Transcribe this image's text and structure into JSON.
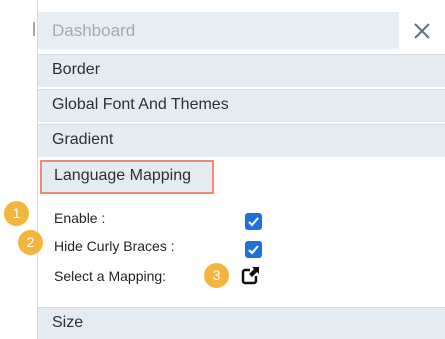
{
  "header": {
    "title": "Dashboard",
    "close_icon": "close-icon"
  },
  "sections": {
    "border": "Border",
    "global_font": "Global Font And Themes",
    "gradient": "Gradient",
    "language_mapping": "Language Mapping",
    "size": "Size"
  },
  "language_mapping": {
    "enable_label": "Enable :",
    "enable_checked": true,
    "hide_braces_label": "Hide Curly Braces :",
    "hide_braces_checked": true,
    "select_mapping_label": "Select a Mapping:",
    "select_mapping_icon": "external-link-icon"
  },
  "badges": [
    "1",
    "2",
    "3"
  ],
  "colors": {
    "header_bg": "#e7eef3",
    "section_bg": "#e4ecf1",
    "highlight_border": "#ec8b7a",
    "checkbox": "#1f73d8",
    "badge": "#f2b63c",
    "close_icon": "#5a7590"
  }
}
